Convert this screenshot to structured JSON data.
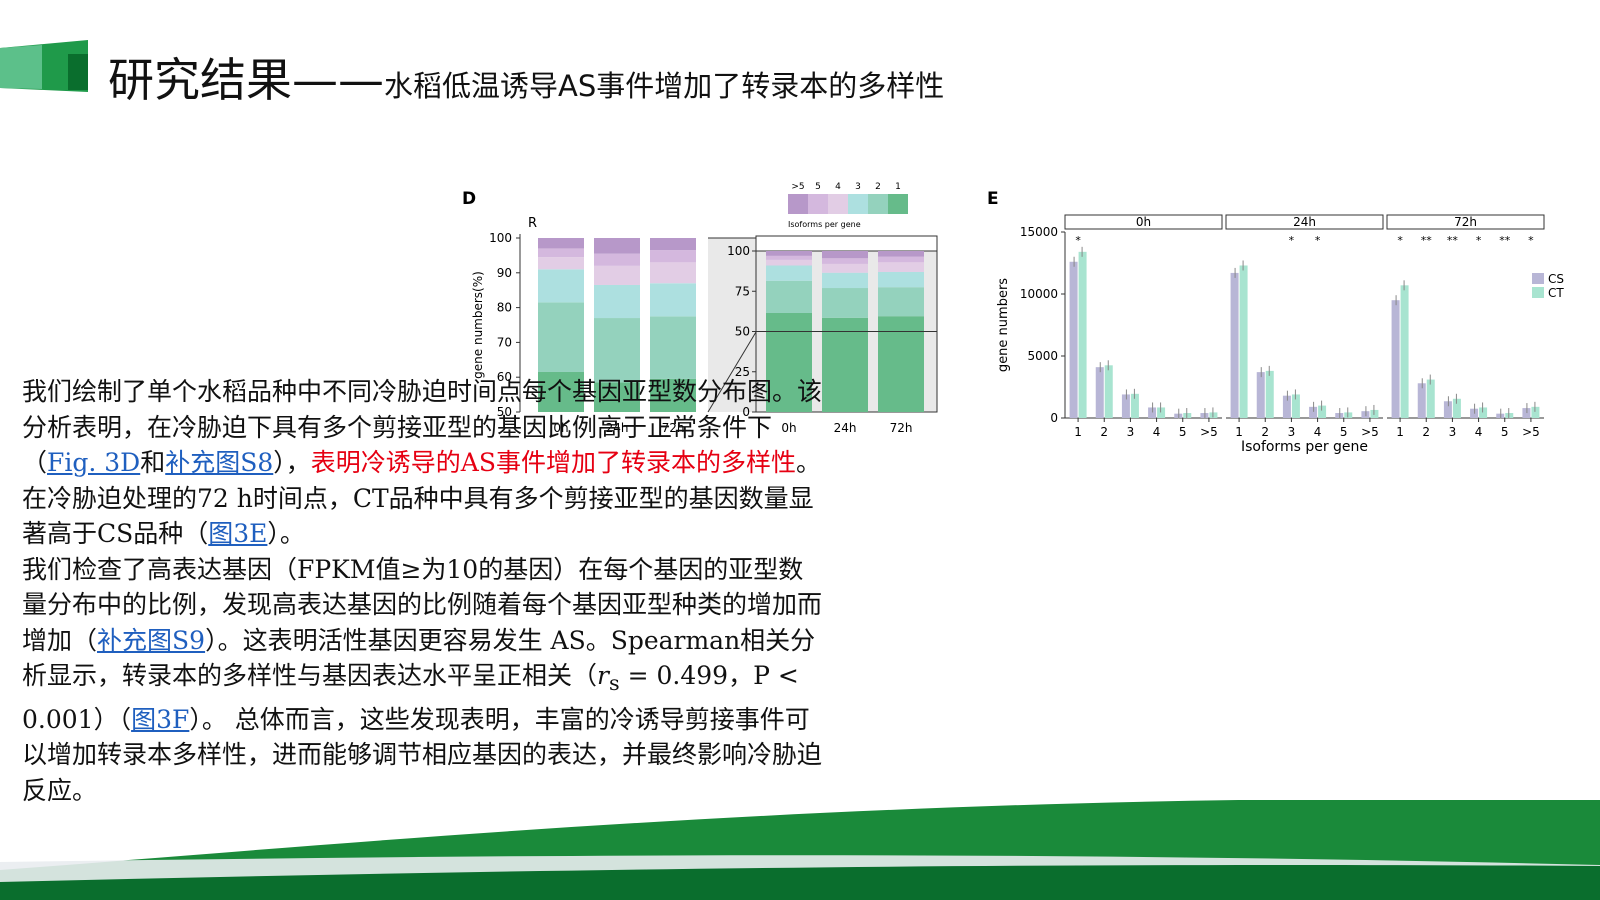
{
  "colors": {
    "accent_green": "#1a8a3a",
    "dark_green": "#0a6e2d",
    "red_text": "#e60012",
    "link_blue": "#1f5fbf",
    "iso_1": "#66bb8a",
    "iso_2": "#94d2bd",
    "iso_3": "#ade0e0",
    "iso_4": "#e2cde5",
    "iso_5": "#d4b8de",
    "iso_gt5": "#b798c9",
    "cs": "#b8b6d6",
    "ct": "#a8e4d0"
  },
  "header": {
    "title_main": "研究结果——",
    "title_sub": "水稻低温诱导AS事件增加了转录本的多样性"
  },
  "body": {
    "p1_part1": "我们绘制了单个水稻品种中不同冷胁迫时间点每个基因亚型数分布图。该分析表明，在冷胁迫下具有多个剪接亚型的基因比例高于正常条件下（",
    "p1_link1": "Fig. 3D",
    "p1_and": "和",
    "p1_link2": "补充图S8",
    "p1_part2": "），",
    "p1_red": "表明冷诱导的AS事件增加了转录本的多样性",
    "p1_part3": "。在冷胁迫处理的72 h时间点，CT品种中具有多个剪接亚型的基因数量显著高于CS品种（",
    "p1_link3": "图3E",
    "p1_part4": "）。",
    "p2_part1": "我们检查了高表达基因（FPKM值≥为10的基因）在每个基因的亚型数量分布中的比例，发现高表达基因的比例随着每个基因亚型种类的增加而增加（",
    "p2_link1": "补充图S9",
    "p2_part2": "）。这表明活性基因更容易发生 AS。Spearman相关分析显示，转录本的多样性与基因表达水平呈正相关（",
    "p2_r": "r",
    "p2_sub": "s",
    "p2_stat": " = 0.499，P < 0.001）（",
    "p2_link2": "图3F",
    "p2_part3": "）。 总体而言，这些发现表明，丰富的冷诱导剪接事件可以增加转录本多样性，进而能够调节相应基因的表达，并最终影响冷胁迫反应。"
  },
  "chart_data": [
    {
      "panel": "D",
      "type": "bar",
      "title": "R",
      "ylabel": "gene numbers(%)",
      "ylim": [
        50,
        100
      ],
      "legend_title": "Isoforms per gene",
      "legend_labels": [
        ">5",
        "5",
        "4",
        "3",
        "2",
        "1"
      ],
      "categories": [
        "0h",
        "24h",
        "72h"
      ],
      "series": [
        {
          "name": "1",
          "values": [
            61.5,
            58.5,
            59.5
          ]
        },
        {
          "name": "2",
          "values": [
            20,
            18.5,
            18
          ]
        },
        {
          "name": "3",
          "values": [
            9.5,
            9.5,
            9.5
          ]
        },
        {
          "name": "4",
          "values": [
            3.5,
            5.5,
            6
          ]
        },
        {
          "name": "5",
          "values": [
            2.5,
            3.5,
            3.5
          ]
        },
        {
          "name": ">5",
          "values": [
            3,
            4.5,
            3.5
          ]
        }
      ],
      "inset": {
        "ylim": [
          0,
          100
        ],
        "yticks": [
          0,
          25,
          50,
          75,
          100
        ],
        "categories": [
          "0h",
          "24h",
          "72h"
        ]
      },
      "yticks": [
        50,
        60,
        70,
        80,
        90,
        100
      ]
    },
    {
      "panel": "E",
      "type": "bar",
      "ylabel": "gene numbers",
      "xlabel": "Isoforms per gene",
      "ylim": [
        0,
        15000
      ],
      "yticks": [
        0,
        5000,
        10000,
        15000
      ],
      "legend": [
        "CS",
        "CT"
      ],
      "categories": [
        "1",
        "2",
        "3",
        "4",
        "5",
        ">5"
      ],
      "facets": [
        {
          "label": "0h",
          "cs": [
            12600,
            4100,
            1900,
            850,
            350,
            400
          ],
          "ct": [
            13400,
            4250,
            1950,
            850,
            400,
            450
          ],
          "stars": [
            "*",
            "",
            "",
            "",
            "",
            ""
          ]
        },
        {
          "label": "24h",
          "cs": [
            11700,
            3700,
            1800,
            900,
            400,
            550
          ],
          "ct": [
            12300,
            3800,
            1900,
            1000,
            450,
            650
          ],
          "stars": [
            "",
            "",
            "*",
            "*",
            "",
            ""
          ]
        },
        {
          "label": "72h",
          "cs": [
            9500,
            2800,
            1350,
            750,
            350,
            800
          ],
          "ct": [
            10700,
            3100,
            1550,
            850,
            400,
            900
          ],
          "stars": [
            "*",
            "**",
            "**",
            "*",
            "**",
            "*"
          ]
        }
      ]
    }
  ]
}
